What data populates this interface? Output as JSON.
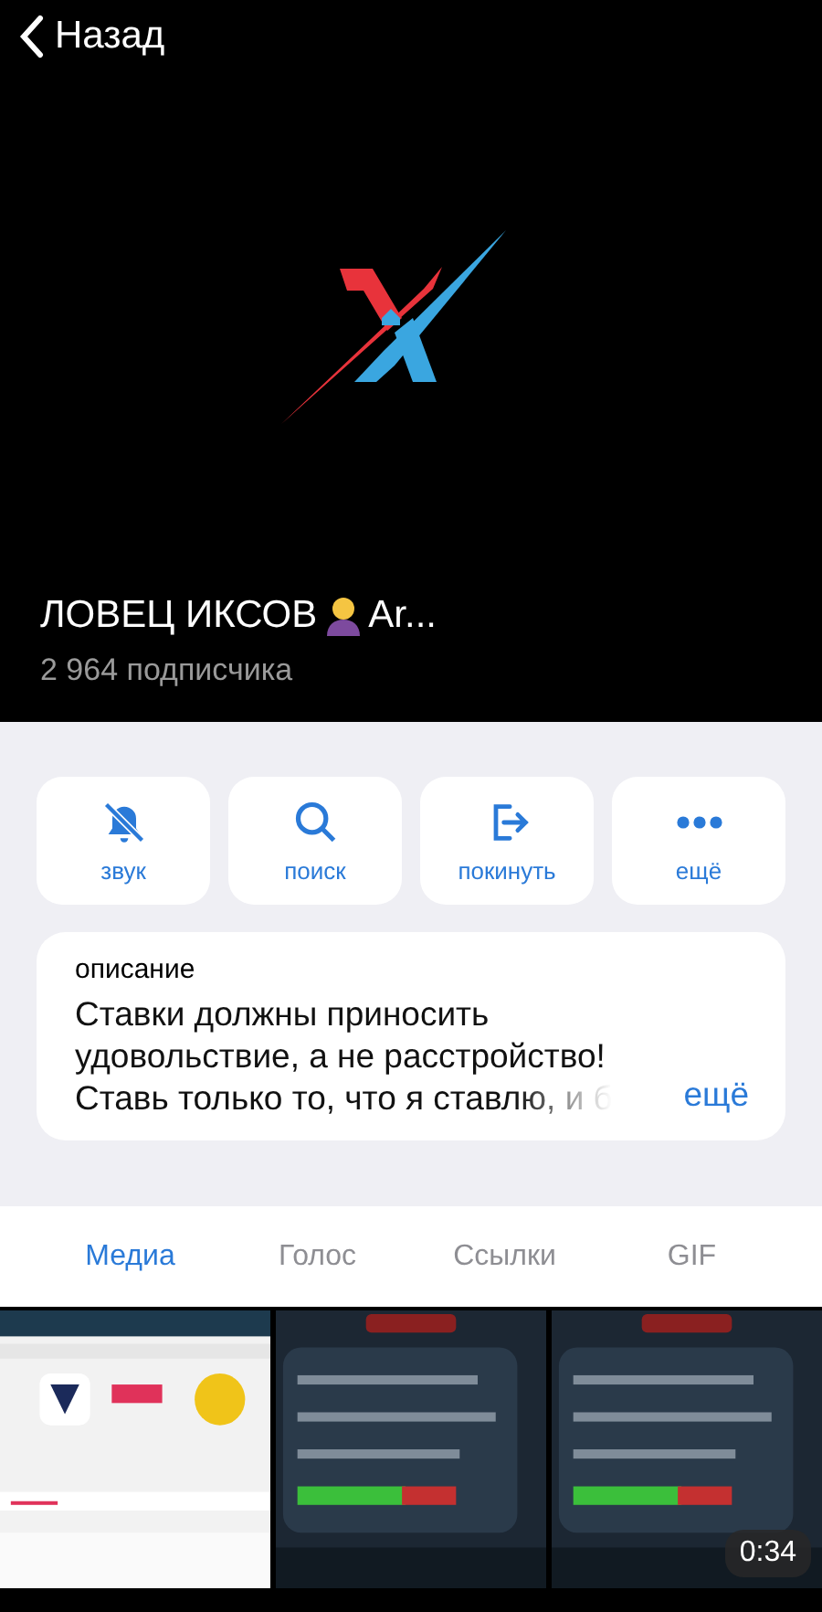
{
  "nav": {
    "back": "Назад"
  },
  "channel": {
    "name": "ЛОВЕЦ ИКСОВ",
    "name_continuation": "Ar...",
    "subscribers": "2 964 подписчика"
  },
  "actions": [
    {
      "kind": "mute",
      "label": "звук"
    },
    {
      "kind": "search",
      "label": "поиск"
    },
    {
      "kind": "leave",
      "label": "покинуть"
    },
    {
      "kind": "more",
      "label": "ещё"
    }
  ],
  "description": {
    "heading": "описание",
    "lines": [
      "Ставки должны приносить",
      "удовольствие, а не расстройство!",
      "Ставь только то, что я ставлю, и б"
    ],
    "more": "ещё"
  },
  "tabs": [
    {
      "label": "Медиа",
      "selected": true
    },
    {
      "label": "Голос",
      "selected": false
    },
    {
      "label": "Ссылки",
      "selected": false
    },
    {
      "label": "GIF",
      "selected": false
    }
  ],
  "media": [
    {
      "kind": "picture"
    },
    {
      "kind": "picture"
    },
    {
      "kind": "picture",
      "duration": "0:34"
    }
  ]
}
